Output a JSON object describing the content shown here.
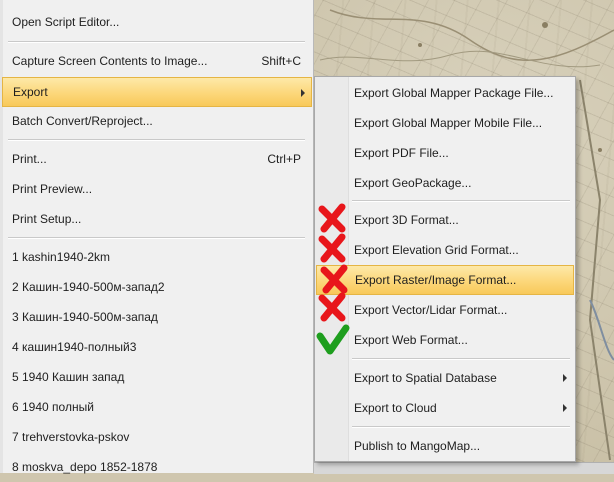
{
  "main_menu": {
    "items": [
      {
        "label": "Open Script Editor...",
        "shortcut": ""
      },
      {
        "label": "Capture Screen Contents to Image...",
        "shortcut": "Shift+C"
      },
      {
        "label": "Export",
        "shortcut": ""
      },
      {
        "label": "Batch Convert/Reproject...",
        "shortcut": ""
      },
      {
        "label": "Print...",
        "shortcut": "Ctrl+P"
      },
      {
        "label": "Print Preview...",
        "shortcut": ""
      },
      {
        "label": "Print Setup...",
        "shortcut": ""
      },
      {
        "label": "1 kashin1940-2km",
        "shortcut": ""
      },
      {
        "label": "2 Кашин-1940-500м-запад2",
        "shortcut": ""
      },
      {
        "label": "3 Кашин-1940-500м-запад",
        "shortcut": ""
      },
      {
        "label": "4 кашин1940-полный3",
        "shortcut": ""
      },
      {
        "label": "5 1940 Кашин запад",
        "shortcut": ""
      },
      {
        "label": "6 1940 полный",
        "shortcut": ""
      },
      {
        "label": "7 trehverstovka-pskov",
        "shortcut": ""
      },
      {
        "label": "8 moskva_depo 1852-1878",
        "shortcut": ""
      }
    ]
  },
  "export_submenu": {
    "items": [
      {
        "label": "Export Global Mapper Package File...",
        "status": ""
      },
      {
        "label": "Export Global Mapper Mobile File...",
        "status": ""
      },
      {
        "label": "Export PDF File...",
        "status": ""
      },
      {
        "label": "Export GeoPackage...",
        "status": ""
      },
      {
        "label": "Export 3D Format...",
        "status": "cross"
      },
      {
        "label": "Export Elevation Grid Format...",
        "status": "cross"
      },
      {
        "label": "Export Raster/Image Format...",
        "status": "cross"
      },
      {
        "label": "Export Vector/Lidar Format...",
        "status": "cross"
      },
      {
        "label": "Export Web Format...",
        "status": "check"
      },
      {
        "label": "Export to Spatial Database",
        "status": ""
      },
      {
        "label": "Export to Cloud",
        "status": ""
      },
      {
        "label": "Publish to MangoMap...",
        "status": ""
      }
    ]
  },
  "colors": {
    "highlight": "#fcd77a",
    "cross": "#e8161b",
    "check": "#1e9e1e"
  },
  "icons": {
    "cross": "red-cross-icon",
    "check": "green-check-icon",
    "submenu_arrow": "chevron-right-icon"
  }
}
